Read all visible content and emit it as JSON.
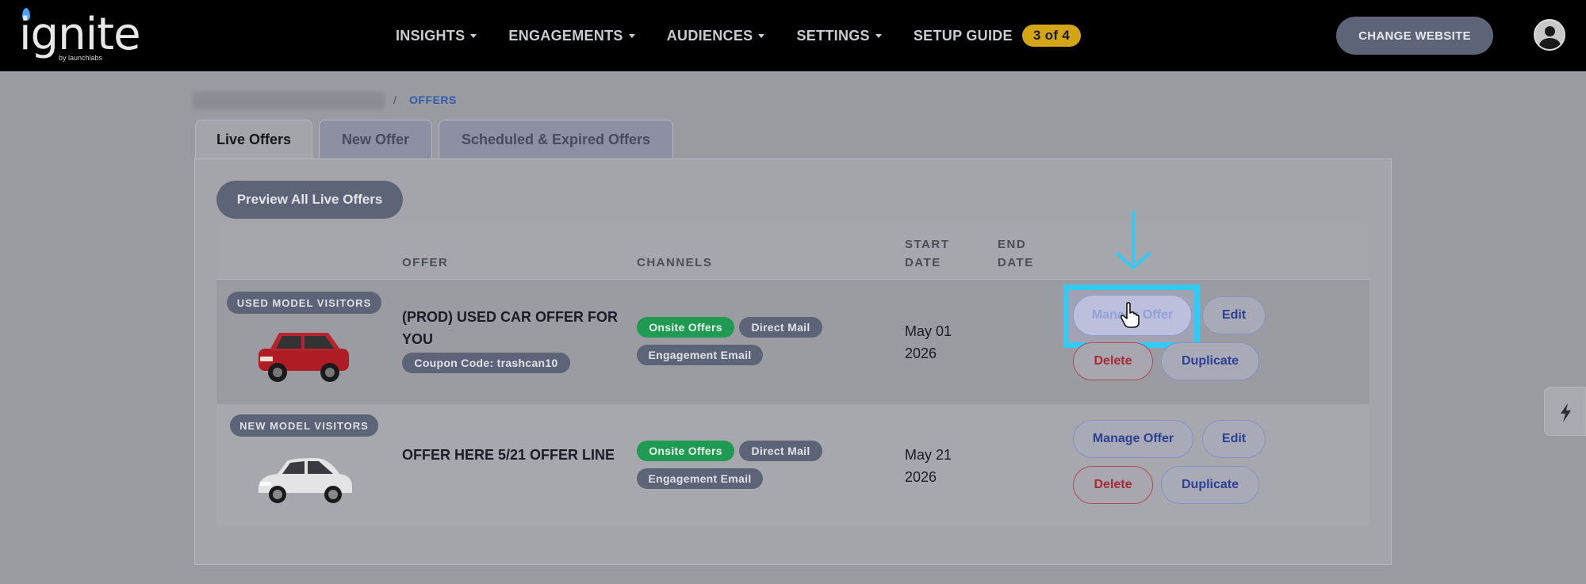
{
  "brand": {
    "name": "ignite",
    "sub": "by launchlabs"
  },
  "nav": {
    "items": [
      {
        "label": "INSIGHTS"
      },
      {
        "label": "ENGAGEMENTS"
      },
      {
        "label": "AUDIENCES"
      },
      {
        "label": "SETTINGS"
      }
    ],
    "setup_guide": {
      "label": "SETUP GUIDE",
      "badge": "3 of 4"
    },
    "change_website": "CHANGE WEBSITE"
  },
  "breadcrumb": {
    "separator": "/",
    "current": "OFFERS"
  },
  "tabs": [
    {
      "label": "Live Offers",
      "active": true
    },
    {
      "label": "New Offer",
      "active": false
    },
    {
      "label": "Scheduled & Expired Offers",
      "active": false
    }
  ],
  "preview_button": "Preview All Live Offers",
  "table": {
    "headers": {
      "offer": "OFFER",
      "channels": "CHANNELS",
      "start_date_1": "START",
      "start_date_2": "DATE",
      "end_date_1": "END",
      "end_date_2": "DATE"
    },
    "rows": [
      {
        "audience": "USED MODEL VISITORS",
        "car_color": "#c0202a",
        "offer_title": "(PROD) USED CAR OFFER FOR YOU",
        "coupon": "Coupon Code: trashcan10",
        "channels": [
          "Onsite Offers",
          "Direct Mail",
          "Engagement Email"
        ],
        "start_date_1": "May 01",
        "start_date_2": "2026",
        "actions": {
          "manage": "Manage Offer",
          "edit": "Edit",
          "delete": "Delete",
          "duplicate": "Duplicate"
        }
      },
      {
        "audience": "NEW MODEL VISITORS",
        "car_color": "#e4e4e6",
        "offer_title": "OFFER HERE 5/21 OFFER LINE",
        "channels": [
          "Onsite Offers",
          "Direct Mail",
          "Engagement Email"
        ],
        "start_date_1": "May 21",
        "start_date_2": "2026",
        "actions": {
          "manage": "Manage Offer",
          "edit": "Edit",
          "delete": "Delete",
          "duplicate": "Duplicate"
        }
      }
    ]
  },
  "colors": {
    "accent": "#33cbf5",
    "badge": "#d4a516",
    "chip_green": "#1e9a52"
  },
  "icons": {
    "side_tab": "lightning-icon",
    "cursor": "hand-pointer-icon",
    "arrow": "arrow-down-icon"
  }
}
